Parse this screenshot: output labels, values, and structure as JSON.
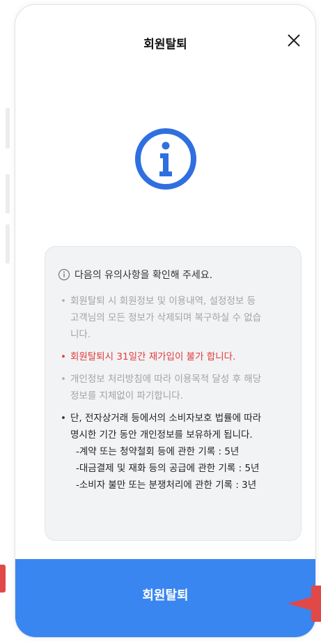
{
  "dialog": {
    "title": "회원탈퇴",
    "close_icon": "close-icon",
    "main_icon": "info-circle-icon"
  },
  "notice": {
    "header_icon": "info-circle-small-icon",
    "header": "다음의 유의사항을 확인해 주세요.",
    "items": [
      {
        "lines": [
          "회원탈퇴 시 회원정보 및 이용내역, 설정정보 등",
          "고객님의 모든 정보가 삭제되며 복구하실 수 없습",
          "니다."
        ],
        "style": "muted"
      },
      {
        "lines": [
          "회원탈퇴시 31일간 재가입이 불가 합니다."
        ],
        "style": "warning"
      },
      {
        "lines": [
          "개인정보 처리방침에 따라 이용목적 달성 후 해당",
          "정보를 지체없이 파기합니다."
        ],
        "style": "muted"
      },
      {
        "lines": [
          "단, 전자상거래 등에서의 소비자보호 법률에 따라",
          "명시한 기간 동안 개인정보를 보유하게 됩니다."
        ],
        "style": "dark",
        "sub_lines": [
          "-계약 또는 청약철회 등에 관한 기록 : 5년",
          "-대금결제 및 재화 등의 공급에 관한 기록 : 5년",
          "-소비자 불만 또는 분쟁처리에 관한 기록 : 3년"
        ]
      }
    ]
  },
  "action": {
    "withdraw_label": "회원탈퇴"
  },
  "colors": {
    "accent": "#3a86f0",
    "warning": "#e23b3b",
    "marker": "#e14848"
  }
}
